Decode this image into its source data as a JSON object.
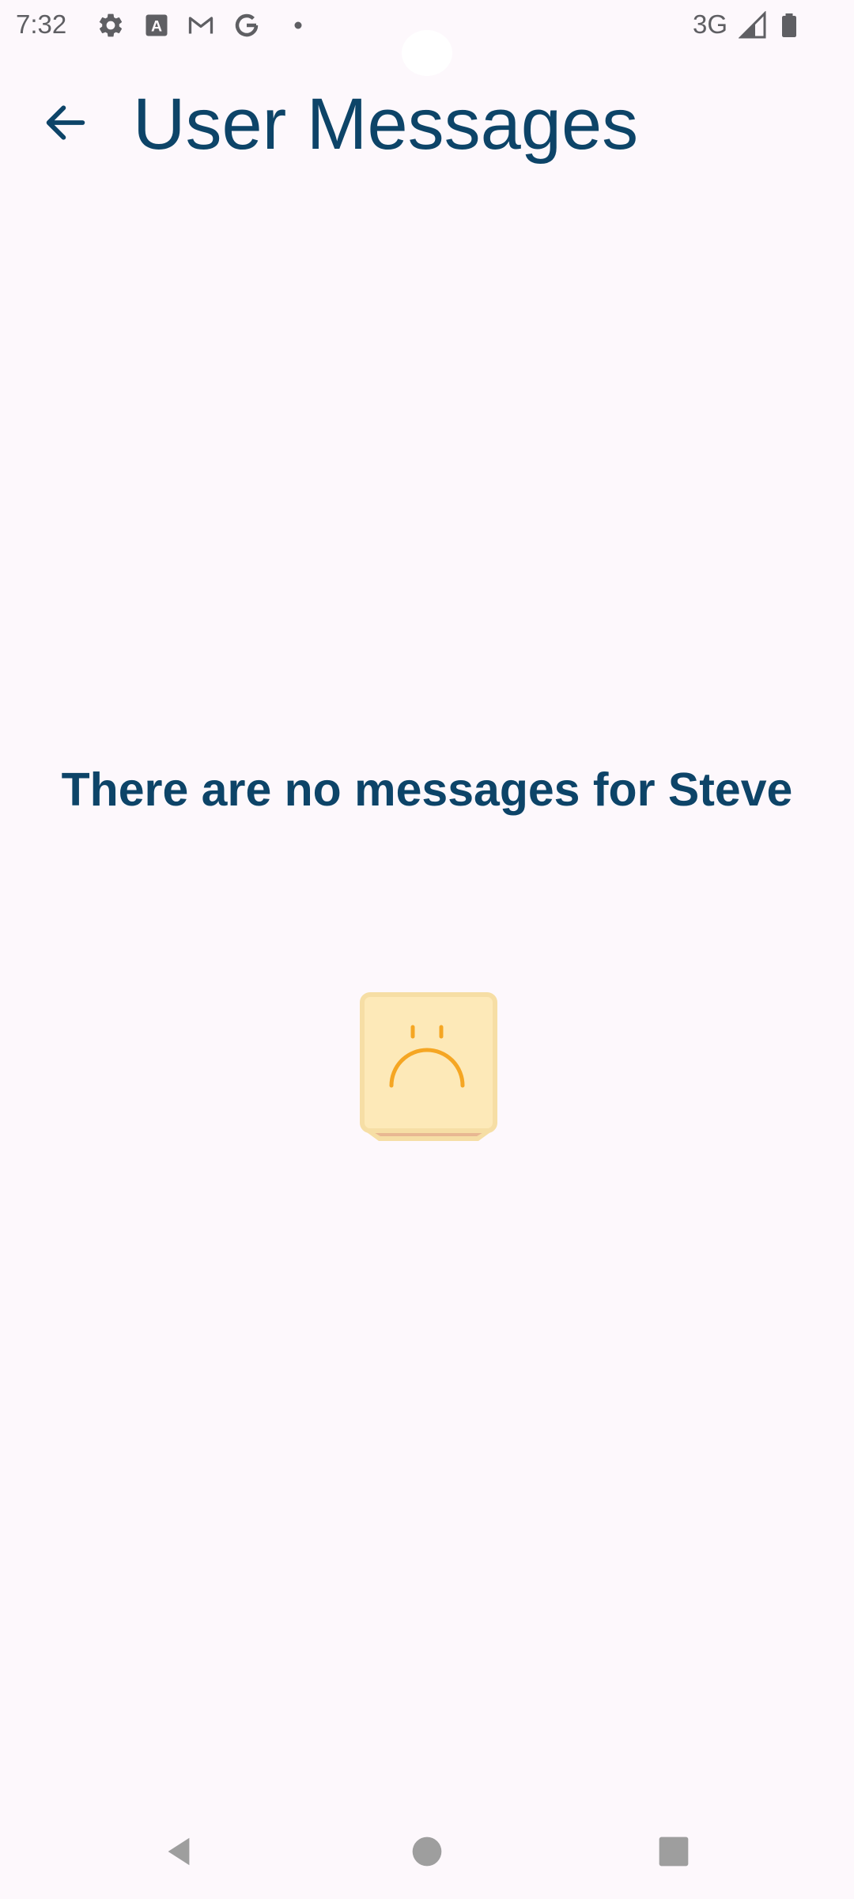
{
  "status_bar": {
    "time": "7:32",
    "network": "3G",
    "icons": [
      "settings-icon",
      "keyboard-a-icon",
      "gmail-icon",
      "google-icon",
      "notification-dot-icon",
      "signal-icon",
      "battery-icon"
    ]
  },
  "app_bar": {
    "title": "User Messages",
    "back_icon": "arrow-back-icon"
  },
  "main": {
    "empty_message": "There are no messages for Steve",
    "illustration": "sad-face-box-icon"
  },
  "nav_bar": {
    "buttons": [
      "back-triangle-icon",
      "home-circle-icon",
      "recents-square-icon"
    ]
  },
  "colors": {
    "background": "#fdf8fc",
    "primary_text": "#0d4468",
    "status_text": "#5f5f63",
    "illustration_fill": "#fde9b8",
    "illustration_border": "#f6dea5",
    "illustration_face": "#f5a623",
    "nav_icons": "#9e9e9e"
  }
}
